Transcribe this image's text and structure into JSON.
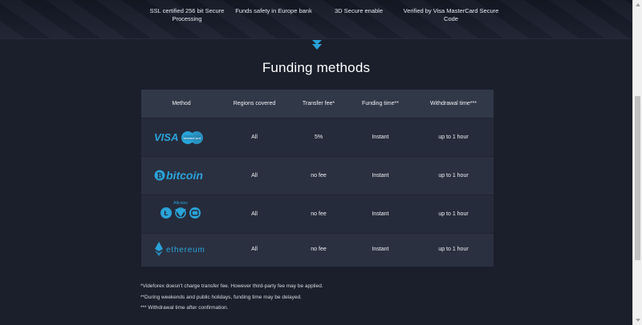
{
  "features": [
    {
      "text": "SSL certified 256 bit Secure Processing"
    },
    {
      "text": "Funds safety in Europe bank"
    },
    {
      "text": "3D Secure enable"
    },
    {
      "text": "Verified by Visa MasterCard Secure Code"
    }
  ],
  "section": {
    "title": "Funding methods"
  },
  "table": {
    "headers": [
      "Method",
      "Regions covered",
      "Transfer fee*",
      "Funding time**",
      "Withdrawal time***"
    ],
    "rows": [
      {
        "method": "VISA / MasterCard",
        "logo_text": "VISA",
        "logo_text2": "MasterCard",
        "regions": "All",
        "fee": "5%",
        "funding": "Instant",
        "withdrawal": "up to 1 hour"
      },
      {
        "method": "bitcoin",
        "logo_text": "bitcoin",
        "regions": "All",
        "fee": "no fee",
        "funding": "Instant",
        "withdrawal": "up to 1 hour"
      },
      {
        "method": "Altcoins",
        "logo_text": "Altcoins",
        "regions": "All",
        "fee": "no fee",
        "funding": "Instant",
        "withdrawal": "up to 1 hour"
      },
      {
        "method": "ethereum",
        "logo_text": "ethereum",
        "regions": "All",
        "fee": "no fee",
        "funding": "Instant",
        "withdrawal": "up to 1 hour"
      }
    ]
  },
  "footnotes": [
    "*Videforex doesn't charge transfer fee. However third-party fee may be applied.",
    "**During weekends and public holidays, funding time may be delayed.",
    "*** Withdrawal time after confirmation."
  ],
  "colors": {
    "accent": "#2aa3d8",
    "background": "#1b1f2b",
    "table": "#262b3b",
    "header": "#313848"
  }
}
